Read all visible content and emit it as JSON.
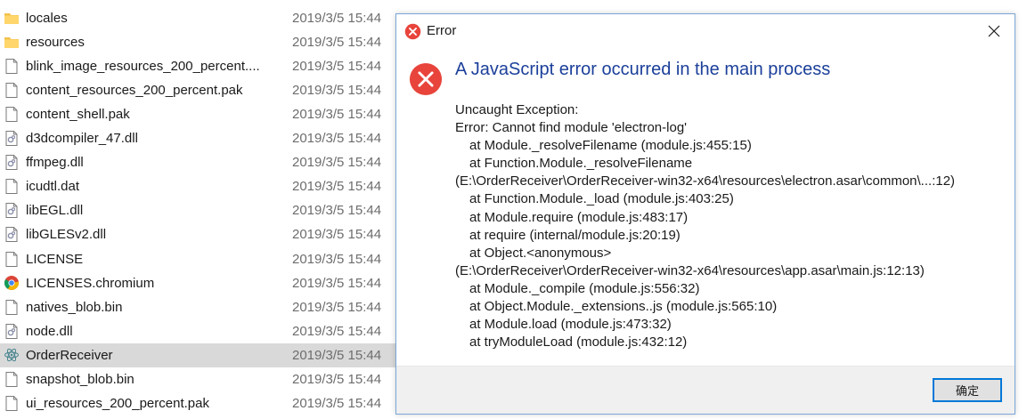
{
  "files": [
    {
      "name": "locales",
      "date": "2019/3/5 15:44",
      "icon": "folder-icon"
    },
    {
      "name": "resources",
      "date": "2019/3/5 15:44",
      "icon": "folder-icon"
    },
    {
      "name": "blink_image_resources_200_percent....",
      "date": "2019/3/5 15:44",
      "icon": "file-icon"
    },
    {
      "name": "content_resources_200_percent.pak",
      "date": "2019/3/5 15:44",
      "icon": "file-icon"
    },
    {
      "name": "content_shell.pak",
      "date": "2019/3/5 15:44",
      "icon": "file-icon"
    },
    {
      "name": "d3dcompiler_47.dll",
      "date": "2019/3/5 15:44",
      "icon": "dll-icon"
    },
    {
      "name": "ffmpeg.dll",
      "date": "2019/3/5 15:44",
      "icon": "dll-icon"
    },
    {
      "name": "icudtl.dat",
      "date": "2019/3/5 15:44",
      "icon": "file-icon"
    },
    {
      "name": "libEGL.dll",
      "date": "2019/3/5 15:44",
      "icon": "dll-icon"
    },
    {
      "name": "libGLESv2.dll",
      "date": "2019/3/5 15:44",
      "icon": "dll-icon"
    },
    {
      "name": "LICENSE",
      "date": "2019/3/5 15:44",
      "icon": "file-icon"
    },
    {
      "name": "LICENSES.chromium",
      "date": "2019/3/5 15:44",
      "icon": "chrome-icon"
    },
    {
      "name": "natives_blob.bin",
      "date": "2019/3/5 15:44",
      "icon": "file-icon"
    },
    {
      "name": "node.dll",
      "date": "2019/3/5 15:44",
      "icon": "dll-icon"
    },
    {
      "name": "OrderReceiver",
      "date": "2019/3/5 15:44",
      "icon": "electron-icon",
      "selected": true
    },
    {
      "name": "snapshot_blob.bin",
      "date": "2019/3/5 15:44",
      "icon": "file-icon"
    },
    {
      "name": "ui_resources_200_percent.pak",
      "date": "2019/3/5 15:44",
      "icon": "file-icon"
    }
  ],
  "dialog": {
    "title": "Error",
    "heading": "A JavaScript error occurred in the main process",
    "message_lines": [
      {
        "text": "Uncaught Exception:",
        "indent": false
      },
      {
        "text": "Error: Cannot find module 'electron-log'",
        "indent": false
      },
      {
        "text": "at Module._resolveFilename (module.js:455:15)",
        "indent": true
      },
      {
        "text": "at Function.Module._resolveFilename",
        "indent": true
      },
      {
        "text": "(E:\\OrderReceiver\\OrderReceiver-win32-x64\\resources\\electron.asar\\common\\...:12)",
        "indent": false
      },
      {
        "text": "at Function.Module._load (module.js:403:25)",
        "indent": true
      },
      {
        "text": "at Module.require (module.js:483:17)",
        "indent": true
      },
      {
        "text": "at require (internal/module.js:20:19)",
        "indent": true
      },
      {
        "text": "at Object.<anonymous>",
        "indent": true
      },
      {
        "text": "(E:\\OrderReceiver\\OrderReceiver-win32-x64\\resources\\app.asar\\main.js:12:13)",
        "indent": false
      },
      {
        "text": "at Module._compile (module.js:556:32)",
        "indent": true
      },
      {
        "text": "at Object.Module._extensions..js (module.js:565:10)",
        "indent": true
      },
      {
        "text": "at Module.load (module.js:473:32)",
        "indent": true
      },
      {
        "text": "at tryModuleLoad (module.js:432:12)",
        "indent": true
      }
    ],
    "ok_label": "确定",
    "close_icon": "close-icon",
    "error_icon": "error-icon"
  },
  "colors": {
    "heading": "#1b3f9a",
    "error_red": "#e8443b",
    "folder": "#f2c14e",
    "selection": "#d9d9d9",
    "focus_border": "#0078d7"
  }
}
